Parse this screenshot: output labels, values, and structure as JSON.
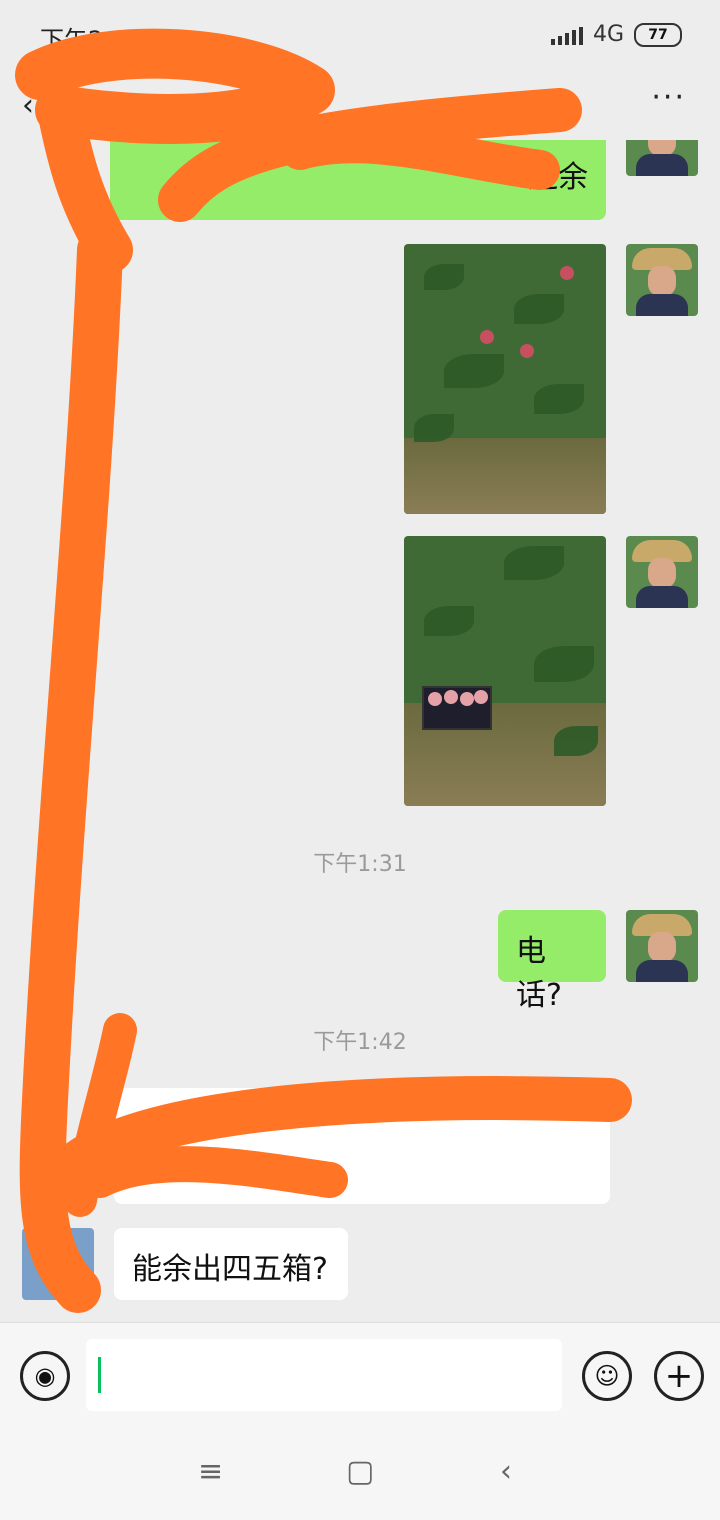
{
  "status": {
    "time": "下午2:04",
    "network": "4G",
    "battery": "77"
  },
  "header": {
    "back_label": "‹",
    "more_label": "···"
  },
  "messages": {
    "first_visible_text": "还余",
    "timestamp_1": "下午1:31",
    "out_phone": "电话?",
    "timestamp_2": "下午1:42",
    "in_partial": "烟",
    "in_question": "能余出四五箱?"
  },
  "input": {
    "placeholder": ""
  },
  "colors": {
    "outgoing_bubble": "#95ec69",
    "incoming_bubble": "#ffffff",
    "background": "#ededed",
    "scribble": "#ff7425"
  }
}
